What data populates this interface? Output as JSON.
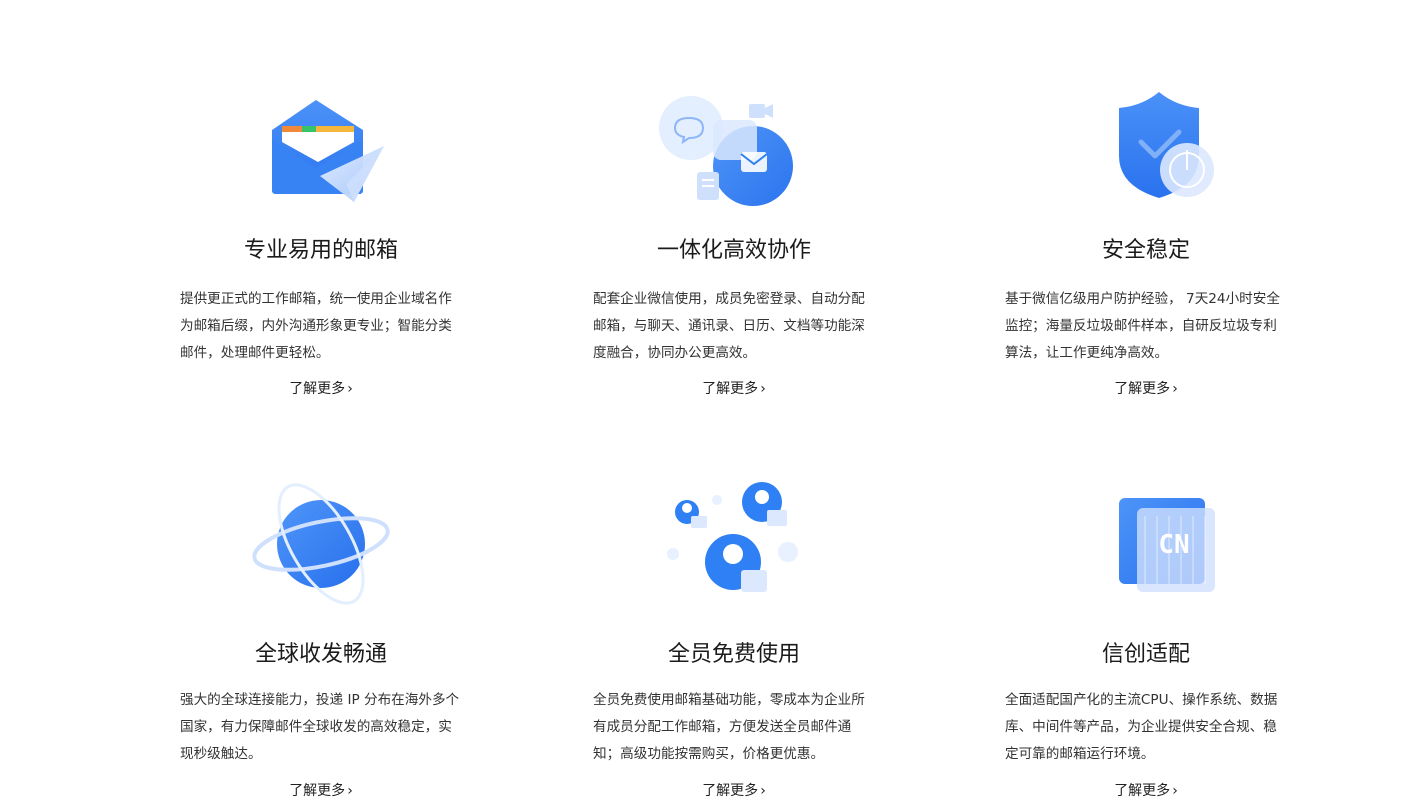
{
  "features": [
    {
      "title": "专业易用的邮箱",
      "desc": "提供更正式的工作邮箱，统一使用企业域名作为邮箱后缀，内外沟通形象更专业；智能分类邮件，处理邮件更轻松。",
      "more": "了解更多",
      "icon": "envelope-plane-icon"
    },
    {
      "title": "一体化高效协作",
      "desc": "配套企业微信使用，成员免密登录、自动分配邮箱，与聊天、通讯录、日历、文档等功能深度融合，协同办公更高效。",
      "more": "了解更多",
      "icon": "collaboration-icon"
    },
    {
      "title": "安全稳定",
      "desc": "基于微信亿级用户防护经验， 7天24小时安全监控；海量反垃圾邮件样本，自研反垃圾专利算法，让工作更纯净高效。",
      "more": "了解更多",
      "icon": "shield-icon"
    },
    {
      "title": "全球收发畅通",
      "desc": "强大的全球连接能力，投递 IP 分布在海外多个国家，有力保障邮件全球收发的高效稳定，实现秒级触达。",
      "more": "了解更多",
      "icon": "globe-orbit-icon"
    },
    {
      "title": "全员免费使用",
      "desc": "全员免费使用邮箱基础功能，零成本为企业所有成员分配工作邮箱，方便发送全员邮件通知；高级功能按需购买，价格更优惠。",
      "more": "了解更多",
      "icon": "members-icon"
    },
    {
      "title": "信创适配",
      "desc": "全面适配国产化的主流CPU、操作系统、数据库、中间件等产品，为企业提供安全合规、稳定可靠的邮箱运行环境。",
      "more": "了解更多",
      "icon": "cn-chip-icon"
    }
  ],
  "colors": {
    "accent": "#2f7ff5",
    "light": "#cfe0fd",
    "text": "#1b1b1b"
  }
}
